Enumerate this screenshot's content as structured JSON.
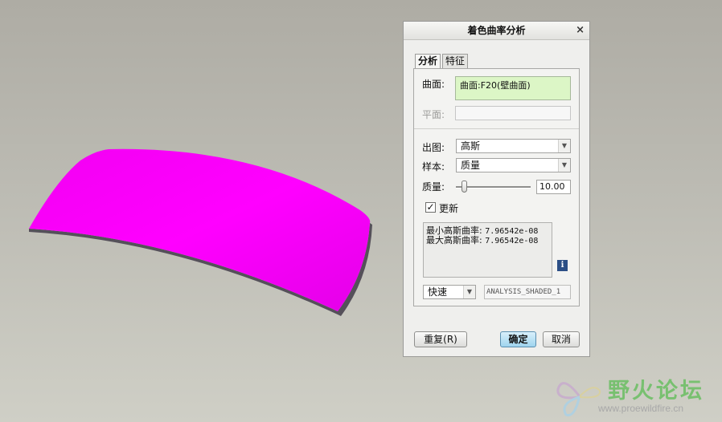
{
  "dialog": {
    "title": "着色曲率分析",
    "close_glyph": "×",
    "tabs": [
      {
        "label": "分析",
        "active": true
      },
      {
        "label": "特征",
        "active": false
      }
    ],
    "surface": {
      "label": "曲面:",
      "value": "曲面:F20(壁曲面)"
    },
    "plane": {
      "label": "平面:",
      "value": ""
    },
    "output": {
      "label": "出图:",
      "selected": "高斯"
    },
    "sample": {
      "label": "样本:",
      "selected": "质量"
    },
    "quality": {
      "label": "质量:",
      "value": "10.00"
    },
    "update": {
      "label": "更新",
      "checked": true
    },
    "results": [
      {
        "label": "最小高斯曲率:",
        "value": "7.96542e-08"
      },
      {
        "label": "最大高斯曲率:",
        "value": "7.96542e-08"
      }
    ],
    "info_glyph": "i",
    "mode": {
      "selected": "快速"
    },
    "analysis_name": "ANALYSIS_SHADED_1",
    "buttons": {
      "repeat": "重复(R)",
      "ok": "确定",
      "cancel": "取消"
    }
  },
  "colors": {
    "surface_fill": "#ff00ff",
    "surface_edge": "#55505a",
    "annotation": "#d8463c",
    "ok_button": "#a6d8f0"
  },
  "watermark": {
    "title": "野火论坛",
    "url": "www.proewildfire.cn"
  }
}
